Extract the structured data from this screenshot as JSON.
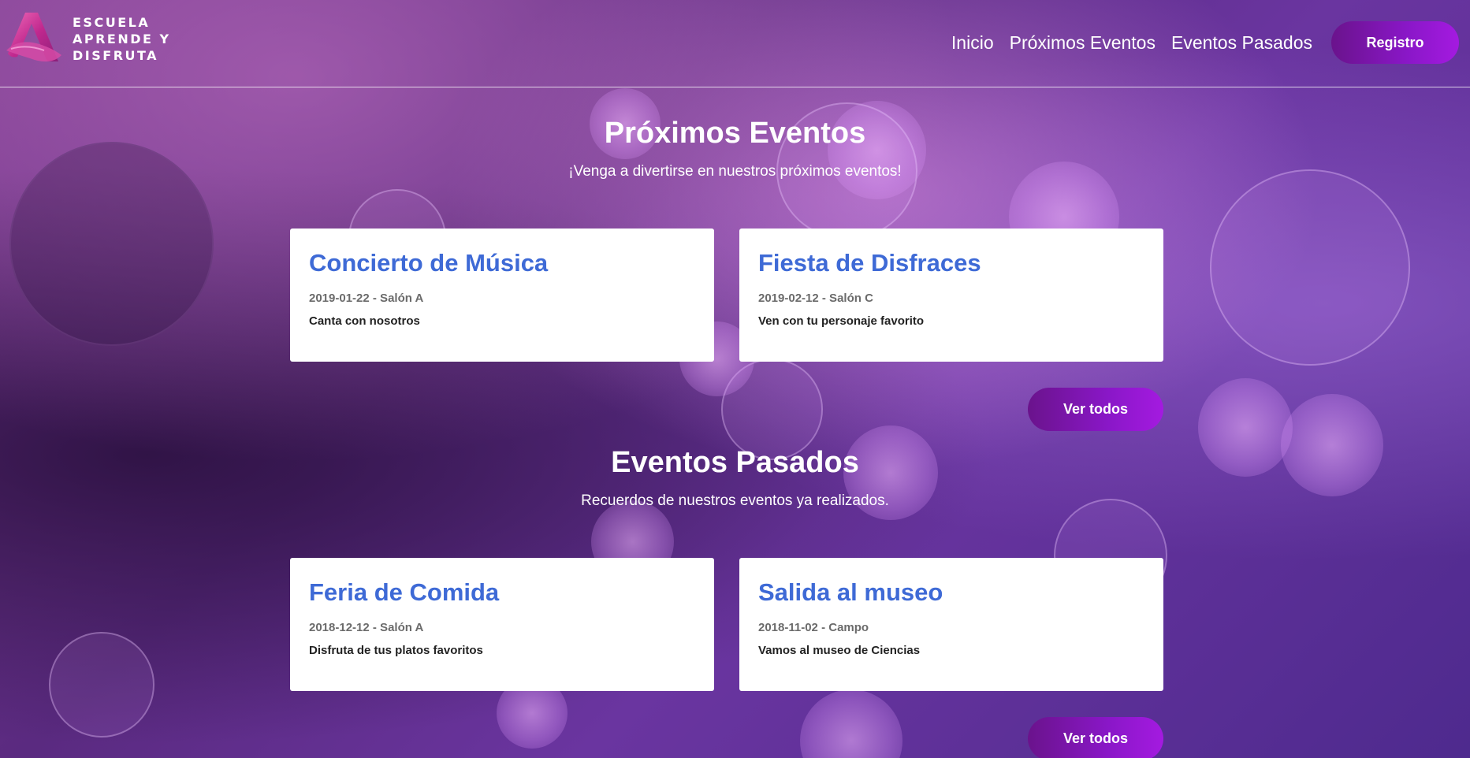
{
  "brand": {
    "logo_lines": [
      "ESCUELA",
      "APRENDE Y",
      "DISFRUTA"
    ]
  },
  "nav": {
    "items": [
      {
        "label": "Inicio"
      },
      {
        "label": "Próximos Eventos"
      },
      {
        "label": "Eventos Pasados"
      }
    ],
    "register_label": "Registro"
  },
  "upcoming": {
    "title": "Próximos Eventos",
    "subtitle": "¡Venga a divertirse en nuestros próximos eventos!",
    "events": [
      {
        "title": "Concierto de Música",
        "meta": "2019-01-22 - Salón A",
        "description": "Canta con nosotros"
      },
      {
        "title": "Fiesta de Disfraces",
        "meta": "2019-02-12 - Salón C",
        "description": "Ven con tu personaje favorito"
      }
    ],
    "more_label": "Ver todos"
  },
  "past": {
    "title": "Eventos Pasados",
    "subtitle": "Recuerdos de nuestros eventos ya realizados.",
    "events": [
      {
        "title": "Feria de Comida",
        "meta": "2018-12-12 - Salón A",
        "description": "Disfruta de tus platos favoritos"
      },
      {
        "title": "Salida al museo",
        "meta": "2018-11-02 - Campo",
        "description": "Vamos al museo de Ciencias"
      }
    ],
    "more_label": "Ver todos"
  },
  "colors": {
    "accent_purple": "#8a17c8",
    "card_title_blue": "#3e6ad6"
  }
}
